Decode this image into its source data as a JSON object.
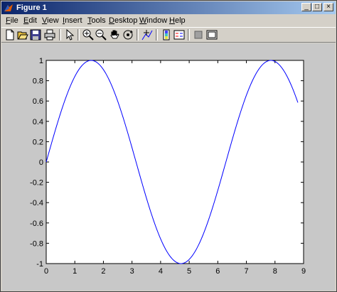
{
  "window": {
    "title": "Figure 1"
  },
  "controls": {
    "minimize": "_",
    "maximize": "□",
    "close": "×"
  },
  "menu": [
    {
      "label": "File",
      "ul": "F",
      "rest": "ile"
    },
    {
      "label": "Edit",
      "ul": "E",
      "rest": "dit"
    },
    {
      "label": "View",
      "ul": "V",
      "rest": "iew"
    },
    {
      "label": "Insert",
      "ul": "I",
      "rest": "nsert"
    },
    {
      "label": "Tools",
      "ul": "T",
      "rest": "ools"
    },
    {
      "label": "Desktop",
      "ul": "D",
      "rest": "esktop"
    },
    {
      "label": "Window",
      "ul": "W",
      "rest": "indow"
    },
    {
      "label": "Help",
      "ul": "H",
      "rest": "elp"
    }
  ],
  "toolbar": {
    "icons": [
      "new-figure-icon",
      "open-file-icon",
      "save-icon",
      "print-icon",
      "edit-plot-arrow-icon",
      "zoom-in-icon",
      "zoom-out-icon",
      "pan-hand-icon",
      "rotate-3d-icon",
      "data-cursor-icon",
      "colorbar-icon",
      "legend-icon",
      "hide-plot-tools-icon",
      "show-plot-tools-icon"
    ]
  },
  "colors": {
    "line": "#0000ff",
    "axes_bg": "#ffffff",
    "figure_bg": "#c8c8c8"
  },
  "chart_data": {
    "type": "line",
    "function": "sin",
    "x_range": [
      0,
      8.8
    ],
    "xlim": [
      0,
      9
    ],
    "ylim": [
      -1,
      1
    ],
    "x_ticks": [
      0,
      1,
      2,
      3,
      4,
      5,
      6,
      7,
      8,
      9
    ],
    "y_ticks": [
      -1,
      -0.8,
      -0.6,
      -0.4,
      -0.2,
      0,
      0.2,
      0.4,
      0.6,
      0.8,
      1
    ],
    "x_tick_labels": [
      "0",
      "1",
      "2",
      "3",
      "4",
      "5",
      "6",
      "7",
      "8",
      "9"
    ],
    "y_tick_labels": [
      "-1",
      "-0.8",
      "-0.6",
      "-0.4",
      "-0.2",
      "0",
      "0.2",
      "0.4",
      "0.6",
      "0.8",
      "1"
    ],
    "grid": false,
    "series": [
      {
        "x": [
          0,
          0.4,
          0.8,
          1.2,
          1.6,
          2.0,
          2.4,
          2.8,
          3.2,
          3.6,
          4.0,
          4.4,
          4.8,
          5.2,
          5.6,
          6.0,
          6.4,
          6.8,
          7.2,
          7.6,
          8.0,
          8.4,
          8.8
        ],
        "y": [
          0,
          0.389,
          0.717,
          0.932,
          1.0,
          0.909,
          0.675,
          0.335,
          -0.058,
          -0.443,
          -0.757,
          -0.952,
          -0.996,
          -0.883,
          -0.631,
          -0.279,
          0.117,
          0.494,
          0.794,
          0.968,
          0.989,
          0.855,
          0.585
        ]
      }
    ]
  }
}
